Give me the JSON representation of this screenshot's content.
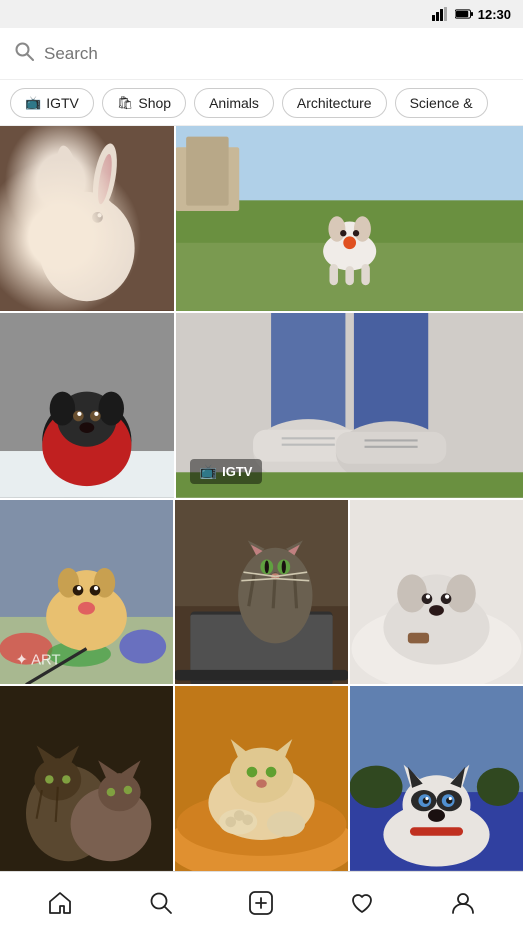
{
  "statusBar": {
    "time": "12:30"
  },
  "search": {
    "placeholder": "Search"
  },
  "tabs": [
    {
      "id": "igtv",
      "label": "IGTV",
      "icon": "📺",
      "active": false
    },
    {
      "id": "shop",
      "label": "Shop",
      "icon": "🛍",
      "active": false
    },
    {
      "id": "animals",
      "label": "Animals",
      "active": false
    },
    {
      "id": "architecture",
      "label": "Architecture",
      "active": false
    },
    {
      "id": "science",
      "label": "Science &",
      "active": false
    }
  ],
  "grid": {
    "rows": [
      {
        "cells": [
          {
            "id": "rabbit",
            "colorClass": "img-rabbit",
            "span": 1,
            "hasIGTV": false
          },
          {
            "id": "dog-grass",
            "colorClass": "img-dog-grass",
            "span": 2,
            "hasIGTV": false
          }
        ]
      },
      {
        "cells": [
          {
            "id": "dog-jacket",
            "colorClass": "img-dog-jacket",
            "span": 1,
            "hasIGTV": false
          },
          {
            "id": "shoes",
            "colorClass": "img-shoes",
            "span": 2,
            "hasIGTV": true,
            "igtvLabel": "IGTV"
          }
        ]
      },
      {
        "cells": [
          {
            "id": "dog-leash",
            "colorClass": "img-dog-leash",
            "span": 1,
            "hasIGTV": false
          },
          {
            "id": "cat-laptop",
            "colorClass": "img-cat-laptop",
            "span": 1,
            "hasIGTV": false
          },
          {
            "id": "dog-white",
            "colorClass": "img-dog-white",
            "span": 1,
            "hasIGTV": false
          }
        ]
      },
      {
        "cells": [
          {
            "id": "cats",
            "colorClass": "img-cats",
            "span": 1,
            "hasIGTV": false
          },
          {
            "id": "cat-orange",
            "colorClass": "img-cat-orange",
            "span": 1,
            "hasIGTV": false
          },
          {
            "id": "husky",
            "colorClass": "img-husky",
            "span": 1,
            "hasIGTV": false
          }
        ]
      }
    ]
  },
  "nav": {
    "items": [
      {
        "id": "home",
        "label": "Home"
      },
      {
        "id": "search",
        "label": "Search"
      },
      {
        "id": "add",
        "label": "Add"
      },
      {
        "id": "heart",
        "label": "Activity"
      },
      {
        "id": "profile",
        "label": "Profile"
      }
    ]
  }
}
